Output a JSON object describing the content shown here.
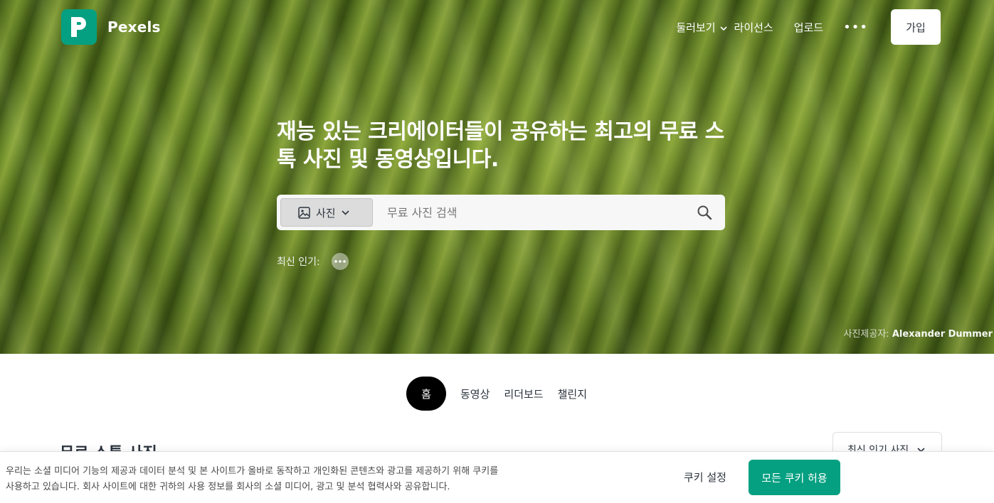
{
  "brand": {
    "name": "Pexels",
    "color": "#05a081"
  },
  "nav": {
    "explore": "둘러보기",
    "license": "라이선스",
    "upload": "업로드",
    "more": "•••",
    "join": "가입"
  },
  "hero": {
    "title": "재능 있는 크리에이터들이 공유하는 최고의 무료 스톡 사진 및 동영상입니다.",
    "search": {
      "type_label": "사진",
      "placeholder": "무료 사진 검색"
    },
    "trending_label": "최신 인기:",
    "credit_prefix": "사진제공자:",
    "credit_name": "Alexander Dummer"
  },
  "tabs": [
    {
      "label": "홈",
      "active": true
    },
    {
      "label": "동영상",
      "active": false
    },
    {
      "label": "리더보드",
      "active": false
    },
    {
      "label": "챌린지",
      "active": false
    }
  ],
  "section": {
    "title": "무료 스톡 사진",
    "sort_label": "최신 인기 사진"
  },
  "cookie": {
    "text": "우리는 소셜 미디어 기능의 제공과 데이터 분석 및 본 사이트가 올바로 동작하고 개인화된 콘텐츠와 광고를 제공하기 위해 쿠키를 사용하고 있습니다. 회사 사이트에 대한 귀하의 사용 정보를 회사의 소셜 미디어, 광고 및 분석 협력사와 공유합니다.",
    "settings": "쿠키 설정",
    "accept_all": "모든 쿠키 허용"
  },
  "icons": {
    "logo": "pexels-logo-icon",
    "explore_chevron": "chevron-down-icon",
    "search_type": "image-icon",
    "search": "search-icon",
    "trending_more": "more-dots-icon"
  }
}
